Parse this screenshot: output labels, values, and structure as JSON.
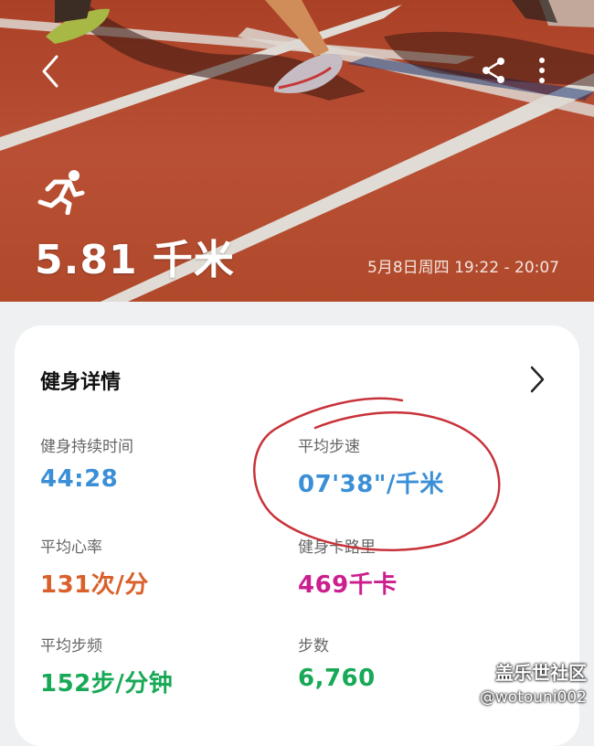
{
  "header": {
    "distance": "5.81 千米",
    "datetime": "5月8日周四 19:22 - 20:07",
    "back_icon": "back-arrow-icon",
    "share_icon": "share-icon",
    "more_icon": "more-vertical-icon",
    "activity_icon": "running-icon"
  },
  "details": {
    "title": "健身详情",
    "metrics": [
      {
        "label": "健身持续时间",
        "value": "44:28",
        "color": "#3a8fd6"
      },
      {
        "label": "平均步速",
        "value": "07'38\"/千米",
        "color": "#3a8fd6"
      },
      {
        "label": "平均心率",
        "value": "131次/分",
        "color": "#d9602a"
      },
      {
        "label": "健身卡路里",
        "value": "469千卡",
        "color": "#cc1f8e"
      },
      {
        "label": "平均步频",
        "value": "152步/分钟",
        "color": "#18a957"
      },
      {
        "label": "步数",
        "value": "6,760",
        "color": "#18a957"
      }
    ]
  },
  "watermark": {
    "line1": "盖乐世社区",
    "line2": "@wotouni002"
  },
  "colors": {
    "track": "#c4522f",
    "annotation": "#c8323a"
  }
}
